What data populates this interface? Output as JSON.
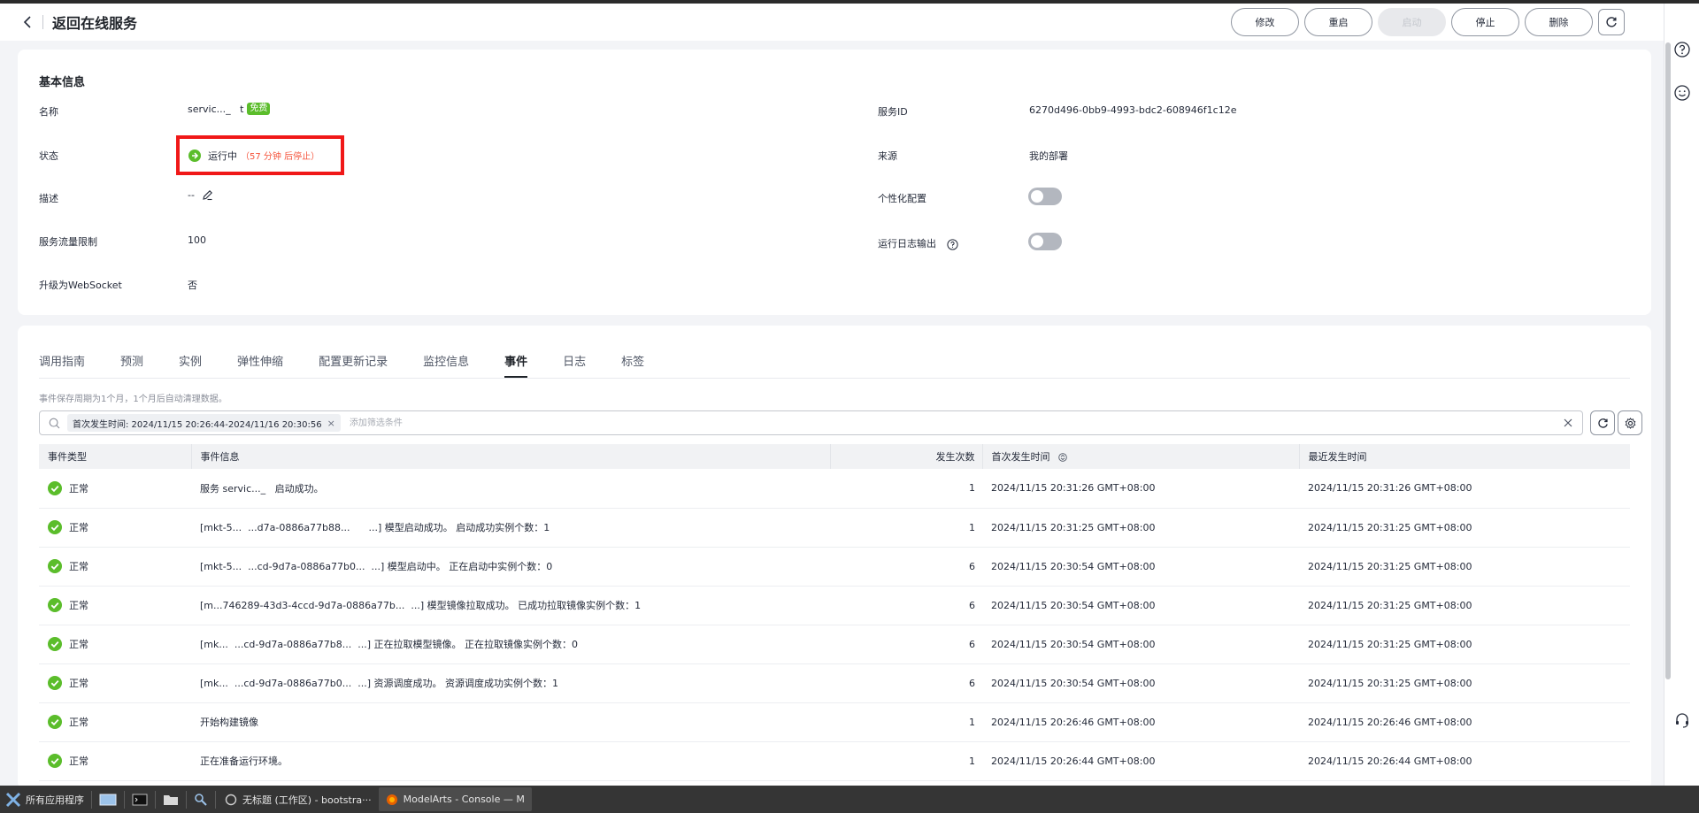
{
  "header": {
    "title": "返回在线服务",
    "actions": {
      "modify": "修改",
      "restart": "重启",
      "start": "启动",
      "stop": "停止",
      "delete": "删除"
    }
  },
  "basic_info": {
    "title": "基本信息",
    "name_label": "名称",
    "name_value": "servic..._   t",
    "name_tag": "免费",
    "service_id_label": "服务ID",
    "service_id_value": "6270d496-0bb9-4993-bdc2-608946f1c12e",
    "status_label": "状态",
    "status_value": "运行中",
    "status_remaining": "（57 分钟 后停止）",
    "source_label": "来源",
    "source_value": "我的部署",
    "description_label": "描述",
    "description_value": "--",
    "personalization_label": "个性化配置",
    "traffic_limit_label": "服务流量限制",
    "traffic_limit_value": "100",
    "run_log_label": "运行日志输出",
    "websocket_label": "升级为WebSocket",
    "websocket_value": "否"
  },
  "tabs": [
    {
      "label": "调用指南"
    },
    {
      "label": "预测"
    },
    {
      "label": "实例"
    },
    {
      "label": "弹性伸缩"
    },
    {
      "label": "配置更新记录"
    },
    {
      "label": "监控信息"
    },
    {
      "label": "事件"
    },
    {
      "label": "日志"
    },
    {
      "label": "标签"
    }
  ],
  "active_tab": "事件",
  "events": {
    "retention_note": "事件保存周期为1个月，1个月后自动清理数据。",
    "filter_tag": "首次发生时间: 2024/11/15 20:26:44-2024/11/16 20:30:56",
    "filter_placeholder": "添加筛选条件",
    "columns": {
      "type": "事件类型",
      "info": "事件信息",
      "count": "发生次数",
      "first_time": "首次发生时间",
      "last_time": "最近发生时间"
    },
    "rows": [
      {
        "type": "正常",
        "info": "服务 servic..._   启动成功。",
        "count": "1",
        "first": "2024/11/15 20:31:26 GMT+08:00",
        "last": "2024/11/15 20:31:26 GMT+08:00"
      },
      {
        "type": "正常",
        "info": "[mkt-5...  ...d7a-0886a77b88...      ...] 模型启动成功。 启动成功实例个数：1",
        "count": "1",
        "first": "2024/11/15 20:31:25 GMT+08:00",
        "last": "2024/11/15 20:31:25 GMT+08:00"
      },
      {
        "type": "正常",
        "info": "[mkt-5...  ...cd-9d7a-0886a77b0...  ...] 模型启动中。 正在启动中实例个数：0",
        "count": "6",
        "first": "2024/11/15 20:30:54 GMT+08:00",
        "last": "2024/11/15 20:31:25 GMT+08:00"
      },
      {
        "type": "正常",
        "info": "[m...746289-43d3-4ccd-9d7a-0886a77b...  ...] 模型镜像拉取成功。 已成功拉取镜像实例个数：1",
        "count": "6",
        "first": "2024/11/15 20:30:54 GMT+08:00",
        "last": "2024/11/15 20:31:25 GMT+08:00"
      },
      {
        "type": "正常",
        "info": "[mk...  ...cd-9d7a-0886a77b8...  ...] 正在拉取模型镜像。 正在拉取镜像实例个数：0",
        "count": "6",
        "first": "2024/11/15 20:30:54 GMT+08:00",
        "last": "2024/11/15 20:31:25 GMT+08:00"
      },
      {
        "type": "正常",
        "info": "[mk...  ...cd-9d7a-0886a77b0...  ...] 资源调度成功。 资源调度成功实例个数：1",
        "count": "6",
        "first": "2024/11/15 20:30:54 GMT+08:00",
        "last": "2024/11/15 20:31:25 GMT+08:00"
      },
      {
        "type": "正常",
        "info": "开始构建镜像",
        "count": "1",
        "first": "2024/11/15 20:26:46 GMT+08:00",
        "last": "2024/11/15 20:26:46 GMT+08:00"
      },
      {
        "type": "正常",
        "info": "正在准备运行环境。",
        "count": "1",
        "first": "2024/11/15 20:26:44 GMT+08:00",
        "last": "2024/11/15 20:26:44 GMT+08:00"
      }
    ]
  },
  "taskbar": {
    "apps_menu": "所有应用程序",
    "window1": "无标题 (工作区) - bootstra···",
    "window2": "ModelArts - Console — M"
  },
  "colors": {
    "accent_green": "#5bbd2b",
    "highlight_red": "#f01818",
    "warning_text": "#f5543c"
  },
  "icons": {
    "back": "chevron-left-icon",
    "refresh": "refresh-icon",
    "help": "question-circle-icon",
    "smile": "smile-icon",
    "service": "headset-icon",
    "status_ok": "check-circle-icon",
    "settings": "gear-icon",
    "search": "search-icon",
    "edit": "pencil-icon",
    "clear": "close-icon"
  }
}
